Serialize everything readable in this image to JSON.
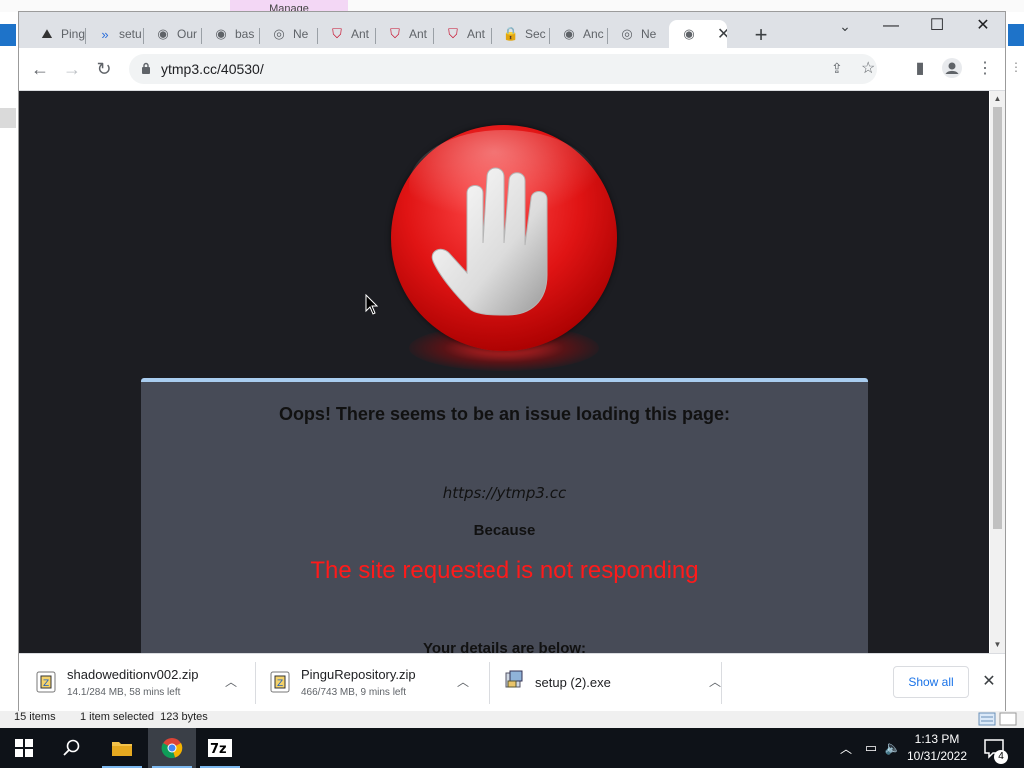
{
  "background": {
    "manage_tab_label": "Manage"
  },
  "browser": {
    "tabs": [
      {
        "title": "Ping",
        "icon": "ping-icon"
      },
      {
        "title": "setu",
        "icon": "chevron-double-icon"
      },
      {
        "title": "Our",
        "icon": "globe-icon"
      },
      {
        "title": "bas",
        "icon": "globe-icon"
      },
      {
        "title": "Ne",
        "icon": "chrome-icon"
      },
      {
        "title": "Ant",
        "icon": "mcafee-shield-icon"
      },
      {
        "title": "Ant",
        "icon": "mcafee-shield-icon"
      },
      {
        "title": "Ant",
        "icon": "mcafee-shield-icon"
      },
      {
        "title": "Sec",
        "icon": "lock-icon"
      },
      {
        "title": "Anc",
        "icon": "globe-icon"
      },
      {
        "title": "Ne",
        "icon": "chrome-icon"
      },
      {
        "title": "",
        "icon": "globe-icon",
        "active": true
      }
    ],
    "url": "ytmp3.cc/40530/"
  },
  "page": {
    "heading": "Oops! There seems to be an issue loading this page:",
    "site_url": "https://ytmp3.cc",
    "because": "Because",
    "error": "The site requested is not responding",
    "details": "Your details are below:"
  },
  "downloads": {
    "items": [
      {
        "name": "shadoweditionv002.zip",
        "status": "14.1/284 MB, 58 mins left",
        "icon": "zip-icon"
      },
      {
        "name": "PinguRepository.zip",
        "status": "466/743 MB, 9 mins left",
        "icon": "zip-icon"
      },
      {
        "name": "setup (2).exe",
        "status": "",
        "icon": "installer-icon"
      }
    ],
    "show_all": "Show all"
  },
  "explorer_status": {
    "items": "15 items",
    "selected": "1 item selected  123 bytes"
  },
  "taskbar": {
    "time": "1:13 PM",
    "date": "10/31/2022",
    "notification_count": "4"
  },
  "colors": {
    "page_background": "#1c1d22",
    "panel_background": "#474b57",
    "panel_border": "#a9cdf0",
    "error_text": "#ff1a1a",
    "link_blue": "#1a73e8"
  }
}
